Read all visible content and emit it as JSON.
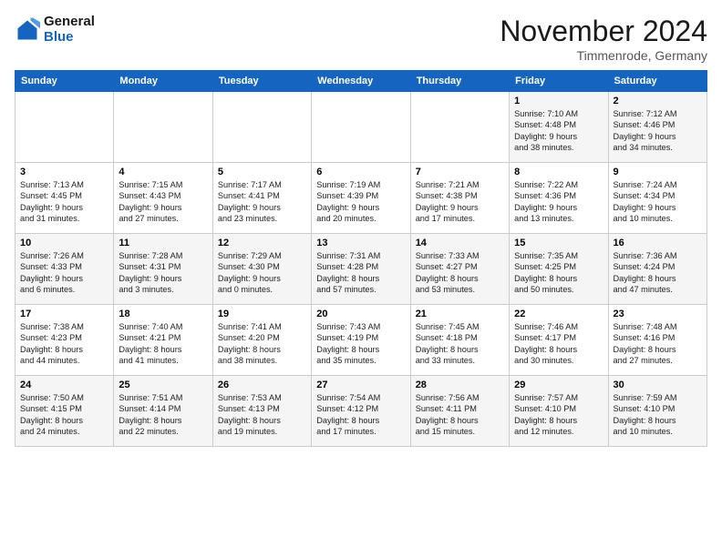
{
  "header": {
    "logo_general": "General",
    "logo_blue": "Blue",
    "title": "November 2024",
    "location": "Timmenrode, Germany"
  },
  "weekdays": [
    "Sunday",
    "Monday",
    "Tuesday",
    "Wednesday",
    "Thursday",
    "Friday",
    "Saturday"
  ],
  "weeks": [
    [
      {
        "day": "",
        "info": ""
      },
      {
        "day": "",
        "info": ""
      },
      {
        "day": "",
        "info": ""
      },
      {
        "day": "",
        "info": ""
      },
      {
        "day": "",
        "info": ""
      },
      {
        "day": "1",
        "info": "Sunrise: 7:10 AM\nSunset: 4:48 PM\nDaylight: 9 hours\nand 38 minutes."
      },
      {
        "day": "2",
        "info": "Sunrise: 7:12 AM\nSunset: 4:46 PM\nDaylight: 9 hours\nand 34 minutes."
      }
    ],
    [
      {
        "day": "3",
        "info": "Sunrise: 7:13 AM\nSunset: 4:45 PM\nDaylight: 9 hours\nand 31 minutes."
      },
      {
        "day": "4",
        "info": "Sunrise: 7:15 AM\nSunset: 4:43 PM\nDaylight: 9 hours\nand 27 minutes."
      },
      {
        "day": "5",
        "info": "Sunrise: 7:17 AM\nSunset: 4:41 PM\nDaylight: 9 hours\nand 23 minutes."
      },
      {
        "day": "6",
        "info": "Sunrise: 7:19 AM\nSunset: 4:39 PM\nDaylight: 9 hours\nand 20 minutes."
      },
      {
        "day": "7",
        "info": "Sunrise: 7:21 AM\nSunset: 4:38 PM\nDaylight: 9 hours\nand 17 minutes."
      },
      {
        "day": "8",
        "info": "Sunrise: 7:22 AM\nSunset: 4:36 PM\nDaylight: 9 hours\nand 13 minutes."
      },
      {
        "day": "9",
        "info": "Sunrise: 7:24 AM\nSunset: 4:34 PM\nDaylight: 9 hours\nand 10 minutes."
      }
    ],
    [
      {
        "day": "10",
        "info": "Sunrise: 7:26 AM\nSunset: 4:33 PM\nDaylight: 9 hours\nand 6 minutes."
      },
      {
        "day": "11",
        "info": "Sunrise: 7:28 AM\nSunset: 4:31 PM\nDaylight: 9 hours\nand 3 minutes."
      },
      {
        "day": "12",
        "info": "Sunrise: 7:29 AM\nSunset: 4:30 PM\nDaylight: 9 hours\nand 0 minutes."
      },
      {
        "day": "13",
        "info": "Sunrise: 7:31 AM\nSunset: 4:28 PM\nDaylight: 8 hours\nand 57 minutes."
      },
      {
        "day": "14",
        "info": "Sunrise: 7:33 AM\nSunset: 4:27 PM\nDaylight: 8 hours\nand 53 minutes."
      },
      {
        "day": "15",
        "info": "Sunrise: 7:35 AM\nSunset: 4:25 PM\nDaylight: 8 hours\nand 50 minutes."
      },
      {
        "day": "16",
        "info": "Sunrise: 7:36 AM\nSunset: 4:24 PM\nDaylight: 8 hours\nand 47 minutes."
      }
    ],
    [
      {
        "day": "17",
        "info": "Sunrise: 7:38 AM\nSunset: 4:23 PM\nDaylight: 8 hours\nand 44 minutes."
      },
      {
        "day": "18",
        "info": "Sunrise: 7:40 AM\nSunset: 4:21 PM\nDaylight: 8 hours\nand 41 minutes."
      },
      {
        "day": "19",
        "info": "Sunrise: 7:41 AM\nSunset: 4:20 PM\nDaylight: 8 hours\nand 38 minutes."
      },
      {
        "day": "20",
        "info": "Sunrise: 7:43 AM\nSunset: 4:19 PM\nDaylight: 8 hours\nand 35 minutes."
      },
      {
        "day": "21",
        "info": "Sunrise: 7:45 AM\nSunset: 4:18 PM\nDaylight: 8 hours\nand 33 minutes."
      },
      {
        "day": "22",
        "info": "Sunrise: 7:46 AM\nSunset: 4:17 PM\nDaylight: 8 hours\nand 30 minutes."
      },
      {
        "day": "23",
        "info": "Sunrise: 7:48 AM\nSunset: 4:16 PM\nDaylight: 8 hours\nand 27 minutes."
      }
    ],
    [
      {
        "day": "24",
        "info": "Sunrise: 7:50 AM\nSunset: 4:15 PM\nDaylight: 8 hours\nand 24 minutes."
      },
      {
        "day": "25",
        "info": "Sunrise: 7:51 AM\nSunset: 4:14 PM\nDaylight: 8 hours\nand 22 minutes."
      },
      {
        "day": "26",
        "info": "Sunrise: 7:53 AM\nSunset: 4:13 PM\nDaylight: 8 hours\nand 19 minutes."
      },
      {
        "day": "27",
        "info": "Sunrise: 7:54 AM\nSunset: 4:12 PM\nDaylight: 8 hours\nand 17 minutes."
      },
      {
        "day": "28",
        "info": "Sunrise: 7:56 AM\nSunset: 4:11 PM\nDaylight: 8 hours\nand 15 minutes."
      },
      {
        "day": "29",
        "info": "Sunrise: 7:57 AM\nSunset: 4:10 PM\nDaylight: 8 hours\nand 12 minutes."
      },
      {
        "day": "30",
        "info": "Sunrise: 7:59 AM\nSunset: 4:10 PM\nDaylight: 8 hours\nand 10 minutes."
      }
    ]
  ]
}
